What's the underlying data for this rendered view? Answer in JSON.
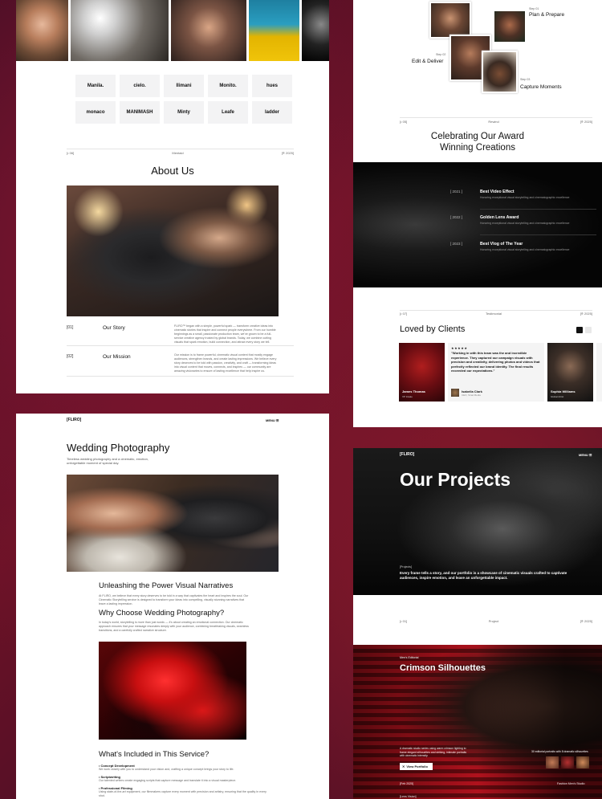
{
  "panelA": {
    "logos": [
      "Manila.",
      "cielo.",
      "Ilimani",
      "Monito.",
      "hues",
      "monaco",
      "MANIMASH",
      "Minty",
      "Leafe",
      "ladder"
    ],
    "meta": {
      "left": "[• 06]",
      "center": "Mentaid",
      "right": "[® 2025]"
    },
    "about_title": "About Us",
    "rows": [
      {
        "num": "[01]",
        "title": "Our Story",
        "text": "FLIRO™ began with a simple, powerful spark — transform creative ideas into cinematic stories that inspire and connect people everywhere. From our humble beginnings as a small, passionate production team, we've grown to be a full-service creative agency trusted by global brands. Today, we combine cutting visuals that spark emotion, build connection, and attract every story we tell."
      },
      {
        "num": "[02]",
        "title": "Our Mission",
        "text": "Our mission is to frame powerful, cinematic visual content that mostly engage audiences, strengthen brands, and create lasting impressions. We believe every story deserves to be told with passion, creativity, and craft — transforming ideas into visual content that moves, connects, and inspires — our community are amazing visionaries to ensure of lasting excellence that help inspire us."
      }
    ]
  },
  "panelB": {
    "steps": [
      {
        "num": "Step 01",
        "label": "Plan & Prepare"
      },
      {
        "num": "Step 02",
        "label": "Edit & Deliver"
      },
      {
        "num": "Step 03",
        "label": "Capture Moments"
      }
    ],
    "meta": {
      "left": "[• 05]",
      "center": "Rewind",
      "right": "[® 2025]"
    },
    "award_title_1": "Celebrating Our Award",
    "award_title_2": "Winning Creations",
    "awards": [
      {
        "year": "[ 2021 ]",
        "title": "Best Video Effect",
        "desc": "Honoring exceptional visual storytelling and cinematographic excellence"
      },
      {
        "year": "[ 2022 ]",
        "title": "Golden Lens Award",
        "desc": "Honoring exceptional visual storytelling and cinematographic excellence"
      },
      {
        "year": "[ 2023 ]",
        "title": "Best Vlog of The Year",
        "desc": "Honoring exceptional visual storytelling and cinematographic excellence"
      }
    ],
    "meta2": {
      "left": "[• 07]",
      "center": "Testimonial",
      "right": "[® 2025]"
    },
    "clients_title": "Loved by Clients",
    "client_left": {
      "name": "James Thomas",
      "role": "VP Intake"
    },
    "quote": {
      "stars": "★★★★★",
      "text": "\"Working in with this team was the and incredible experience. They captured our campaign visuals with precision and creativity, delivering photos and videos that perfectly reflected our brand identity. The final results exceeded our expectations.\"",
      "author": "Isabella Clark",
      "role": "CEO, Sinai Media"
    },
    "client_right": {
      "name": "Sophia Williams",
      "role": "Global Artist"
    }
  },
  "panelC": {
    "brand": "[FLIRO]",
    "menu": "MENU ☰",
    "title": "Wedding Photography",
    "subtitle": "Timeless wedding photography and a cinematic, emotion, unforgettable moment of special day.",
    "h_power": "Unleashing the Power Visual Narratives",
    "p_power": "At FLIRO, we believe that every story deserves to be told in a way that captivates the heart and inspires the soul. Our Cinematic Storytelling service is designed to transform your ideas into compelling, visually stunning narratives that leave a lasting impression.",
    "h_why": "Why Choose Wedding Photography?",
    "p_why": "In today's world, storytelling is more than just words — it's about creating an emotional connection. Our cinematic approach ensures that your message resonates deeply with your audience, combining breathtaking visuals, seamless transitions, and a carefully crafted narrative structure.",
    "h_included": "What's Included in This Service?",
    "items": [
      {
        "title": "• Concept Development",
        "text": "We work closely with you to understand your vision and, crafting a unique concept brings your story to life."
      },
      {
        "title": "• Scriptwriting",
        "text": "Our talented writers create engaging scripts that capture message and translate it into a visual masterpiece."
      },
      {
        "title": "• Professional Filming",
        "text": "Using state-of-the-art equipment, our filmmakers capture every moment with precision and artistry, ensuring that the quality in every shot."
      }
    ]
  },
  "panelD": {
    "brand": "[FLIRO]",
    "menu": "MENU ☰",
    "title": "Our Projects",
    "tag": "[Projects]",
    "intro": "Every frame tells a story, and our portfolio is a showcase of cinematic visuals crafted to captivate audiences, inspire emotion, and leave an unforgettable impact.",
    "meta": {
      "left": "[• 01]",
      "center": "Project",
      "right": "[® 2025]"
    },
    "project_tag": "Men's Editorial",
    "project_title": "Crimson Silhouettes",
    "project_desc": "A dramatic studio series using warm crimson lighting to frame elegant silhouettes and striking, intimate portraits with cinematic intensity.",
    "view_btn": "View Portfolio",
    "editorial": "30 editorial portraits with 8 dramatic silhouettes",
    "footer_left": "[Feb 2025]",
    "footer_right": "Fashion Men's Studio",
    "next_tag": "[Lens Vision]"
  },
  "colors": {
    "accent": "#e0142a",
    "dark": "#0b0b0b",
    "background": "#5a0f26"
  }
}
